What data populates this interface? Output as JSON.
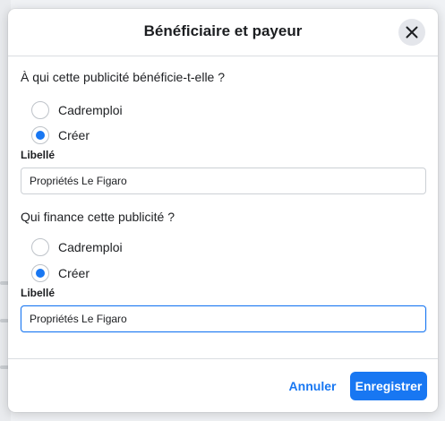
{
  "dialog": {
    "title": "Bénéficiaire et payeur",
    "close_icon": "close-icon"
  },
  "beneficiary": {
    "question": "À qui cette publicité bénéficie-t-elle ?",
    "options": [
      {
        "label": "Cadremploi",
        "selected": false
      },
      {
        "label": "Créer",
        "selected": true
      }
    ],
    "field_label": "Libellé",
    "value": "Propriétés Le Figaro"
  },
  "payer": {
    "question": "Qui finance cette publicité ?",
    "options": [
      {
        "label": "Cadremploi",
        "selected": false
      },
      {
        "label": "Créer",
        "selected": true
      }
    ],
    "field_label": "Libellé",
    "value": "Propriétés Le Figaro"
  },
  "footer": {
    "cancel_label": "Annuler",
    "save_label": "Enregistrer"
  },
  "colors": {
    "accent": "#1877f2",
    "text": "#1c1e21",
    "border": "#ccd0d5"
  }
}
